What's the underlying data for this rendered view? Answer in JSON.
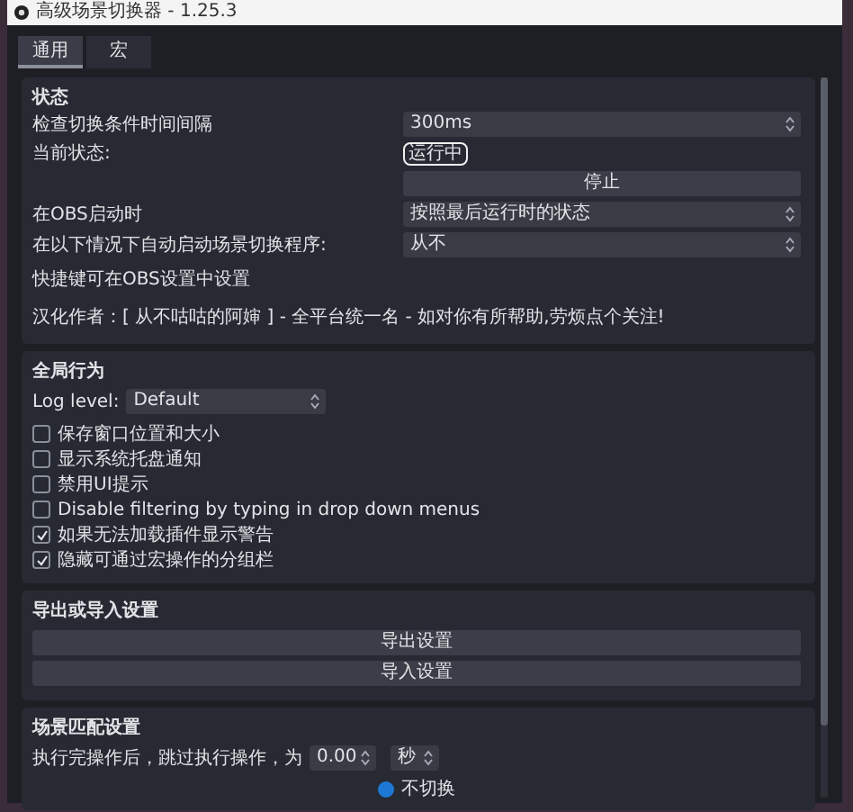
{
  "window": {
    "title": "高级场景切换器 - 1.25.3"
  },
  "tabs": [
    {
      "label": "通用",
      "selected": true
    },
    {
      "label": "宏",
      "selected": false
    }
  ],
  "sections": [
    {
      "title": "状态",
      "rows": [
        {
          "kind": "spin",
          "label": "检查切换条件时间间隔",
          "value": "300ms"
        },
        {
          "kind": "badge",
          "label": "当前状态:",
          "value": "运行中"
        },
        {
          "kind": "button",
          "label": "停止"
        },
        {
          "kind": "combo",
          "label": "在OBS启动时",
          "value": "按照最后运行时的状态"
        },
        {
          "kind": "combo",
          "label": "在以下情况下自动启动场景切换程序:",
          "value": "从不"
        },
        {
          "kind": "note",
          "label": "快捷键可在OBS设置中设置"
        },
        {
          "kind": "note",
          "label": "汉化作者：[ 从不咕咕的阿婶 ] - 全平台统一名 - 如对你有所帮助,劳烦点个关注!"
        }
      ]
    },
    {
      "title": "全局行为",
      "rows": [
        {
          "kind": "inline_combo",
          "label": "Log level:",
          "value": "Default"
        },
        {
          "kind": "checkbox",
          "label": "保存窗口位置和大小",
          "checked": false
        },
        {
          "kind": "checkbox",
          "label": "显示系统托盘通知",
          "checked": false
        },
        {
          "kind": "checkbox",
          "label": "禁用UI提示",
          "checked": false
        },
        {
          "kind": "checkbox",
          "label": "Disable filtering by typing in drop down menus",
          "checked": false
        },
        {
          "kind": "checkbox",
          "label": "如果无法加载插件显示警告",
          "checked": true
        },
        {
          "kind": "checkbox",
          "label": "隐藏可通过宏操作的分组栏",
          "checked": true
        }
      ]
    },
    {
      "title": "导出或导入设置",
      "rows": [
        {
          "kind": "wide_button",
          "label": "导出设置"
        },
        {
          "kind": "wide_button",
          "label": "导入设置"
        }
      ]
    },
    {
      "title": "场景匹配设置",
      "rows": [
        {
          "kind": "delay",
          "label": "执行完操作后，跳过执行操作，为",
          "value": "0.00",
          "unit": "秒"
        },
        {
          "kind": "radio",
          "label": "不切换",
          "selected": true
        }
      ]
    }
  ]
}
